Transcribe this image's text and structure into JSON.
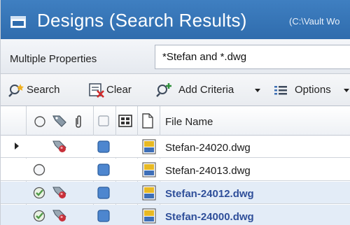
{
  "window": {
    "title": "Designs  (Search Results)",
    "path": "(C:\\Vault Wo"
  },
  "search": {
    "property_label": "Multiple Properties",
    "query": "*Stefan and *.dwg"
  },
  "toolbar": {
    "search_label": "Search",
    "clear_label": "Clear",
    "add_criteria_label": "Add Criteria",
    "options_label": "Options"
  },
  "grid": {
    "columns": {
      "file_name": "File Name",
      "status_icon": "status-circle-icon",
      "property_icon": "pushpin-tag-icon",
      "attachment_icon": "paperclip-icon",
      "checkbox_icon": "checkbox-icon",
      "grid_icon": "thumbnail-grid-icon",
      "doc_icon": "document-icon"
    },
    "rows": [
      {
        "file_name": "Stefan-24020.dwg",
        "status": "none",
        "marker": "row-pointer",
        "pinned": true,
        "bold": false
      },
      {
        "file_name": "Stefan-24013.dwg",
        "status": "empty-circle",
        "marker": "",
        "pinned": false,
        "bold": false
      },
      {
        "file_name": "Stefan-24012.dwg",
        "status": "checked",
        "marker": "",
        "pinned": true,
        "bold": true
      },
      {
        "file_name": "Stefan-24000.dwg",
        "status": "checked",
        "marker": "",
        "pinned": true,
        "bold": true
      }
    ]
  },
  "colors": {
    "title_bar": "#3a78bb",
    "bold_file_text": "#2f4f9a",
    "checked_green": "#4f9a46",
    "pin_red": "#c8303a",
    "blue_square": "#4d86cf"
  }
}
